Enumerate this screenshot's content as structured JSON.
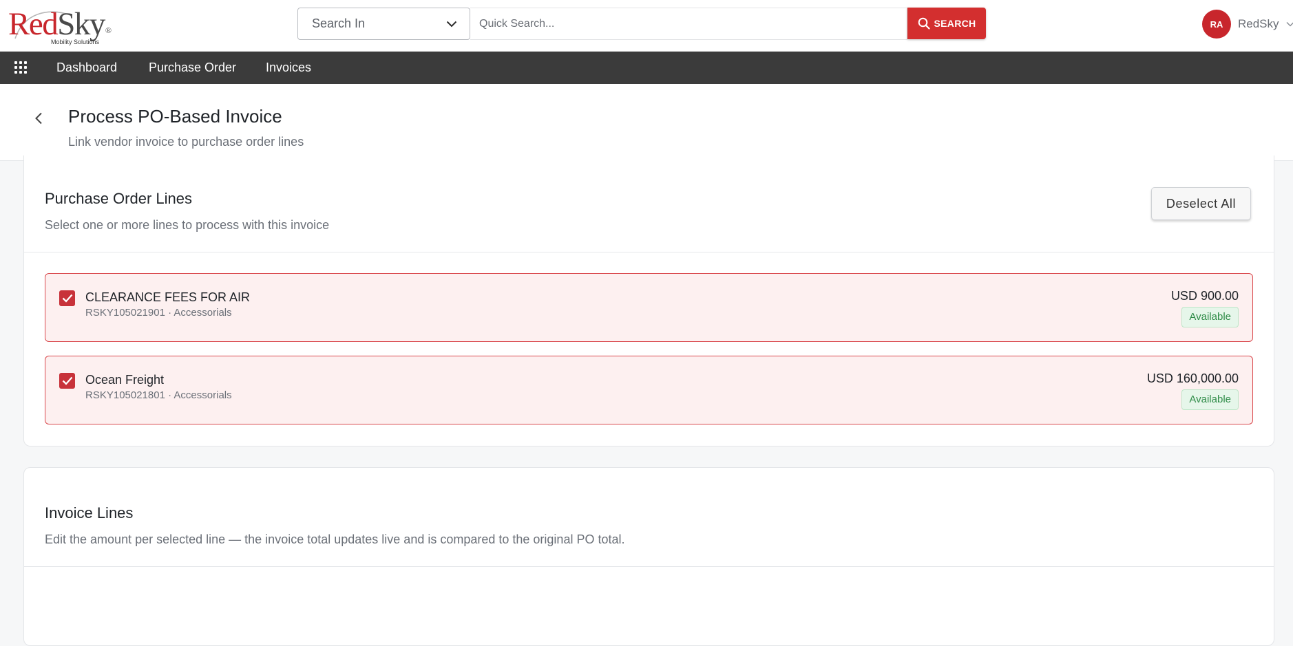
{
  "header": {
    "logo": {
      "brand_red": "Red",
      "brand_gray": "Sky",
      "registered": "®",
      "tagline": "Mobility Solutions"
    },
    "search_in_label": "Search In",
    "quick_search_placeholder": "Quick Search...",
    "search_button_label": "SEARCH",
    "user": {
      "initials": "RA",
      "name": "RedSky"
    }
  },
  "nav": {
    "items": [
      {
        "label": "Dashboard"
      },
      {
        "label": "Purchase Order"
      },
      {
        "label": "Invoices"
      }
    ]
  },
  "page": {
    "title": "Process PO-Based Invoice",
    "subtitle": "Link vendor invoice to purchase order lines"
  },
  "po_lines": {
    "title": "Purchase Order Lines",
    "subtitle": "Select one or more lines to process with this invoice",
    "deselect_label": "Deselect All",
    "lines": [
      {
        "name": "CLEARANCE FEES FOR AIR",
        "meta": "RSKY105021901 · Accessorials",
        "amount": "USD 900.00",
        "status": "Available",
        "checked": true
      },
      {
        "name": "Ocean Freight",
        "meta": "RSKY105021801 · Accessorials",
        "amount": "USD 160,000.00",
        "status": "Available",
        "checked": true
      }
    ]
  },
  "invoice_lines": {
    "title": "Invoice Lines",
    "subtitle": "Edit the amount per selected line — the invoice total updates live and is compared to the original PO total."
  },
  "colors": {
    "brand_red": "#c8262c",
    "nav_bg": "#3b3b3b",
    "selected_bg": "#fdf0f0",
    "selected_border": "#d9474b",
    "available_green": "#2e8b47"
  },
  "icons": {
    "search_in_chevron": "chevron-down-icon",
    "search_button": "search-icon",
    "user_menu": "chevron-down-icon",
    "nav_apps": "apps-grid-icon",
    "back": "chevron-left-icon",
    "checkbox": "check-icon"
  }
}
